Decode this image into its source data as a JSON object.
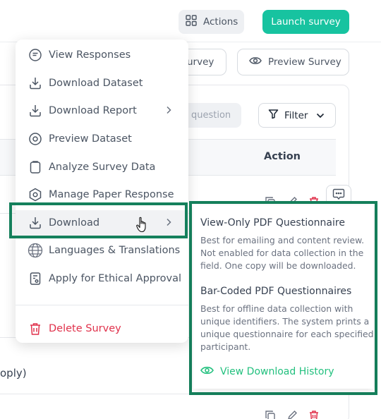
{
  "header": {
    "actions_label": "Actions",
    "launch_label": "Launch survey"
  },
  "toolbar": {
    "edit_survey_label": "urvey",
    "preview_survey_label": "Preview Survey",
    "search_placeholder": "question",
    "filter_label": "Filter"
  },
  "table": {
    "action_header": "Action",
    "partial_row_text": "oply)"
  },
  "menu": {
    "items": [
      {
        "label": "View Responses",
        "icon": "view-responses-icon"
      },
      {
        "label": "Download Dataset",
        "icon": "download-icon"
      },
      {
        "label": "Download Report",
        "icon": "download-icon",
        "has_submenu": true
      },
      {
        "label": "Preview Dataset",
        "icon": "eye-icon"
      },
      {
        "label": "Analyze Survey Data",
        "icon": "clipboard-icon"
      },
      {
        "label": "Manage Paper Response",
        "icon": "hexagon-icon"
      },
      {
        "label": "Download",
        "icon": "download-icon",
        "has_submenu": true,
        "active": true
      },
      {
        "label": "Languages & Translations",
        "icon": "globe-icon"
      },
      {
        "label": "Apply for Ethical Approval",
        "icon": "document-icon"
      }
    ],
    "delete_label": "Delete Survey"
  },
  "submenu": {
    "option1_title": "View-Only PDF Questionnaire",
    "option1_desc": "Best for emailing and content review. Not enabled for data collection in the field. One copy will be downloaded.",
    "option2_title": "Bar-Coded PDF Questionnaires",
    "option2_desc": "Best for offline data collection with unique identifiers. The system prints a unique questionnaire for each specified participant.",
    "history_label": "View Download History"
  },
  "colors": {
    "accent": "#17c3a0",
    "danger": "#e0314b",
    "highlight_border": "#15805c",
    "link_green": "#22c07e"
  }
}
